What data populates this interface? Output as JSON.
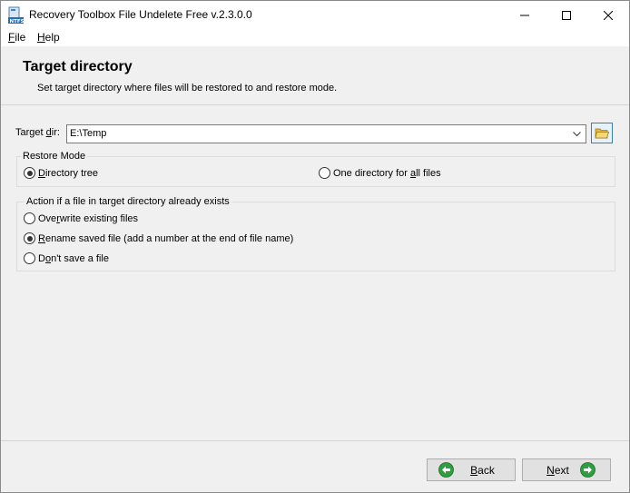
{
  "window": {
    "title": "Recovery Toolbox File Undelete Free v.2.3.0.0",
    "icon": "ntfs-app-icon"
  },
  "menu": {
    "file_first": "F",
    "file_rest": "ile",
    "help_first": "H",
    "help_rest": "elp"
  },
  "header": {
    "title": "Target directory",
    "subtitle": "Set target directory where files will be restored to and restore mode."
  },
  "target": {
    "label_pre": "Target ",
    "label_ul": "d",
    "label_post": "ir:",
    "value": "E:\\Temp"
  },
  "restore_mode": {
    "title": "Restore Mode",
    "options": [
      {
        "pre": "",
        "ul": "D",
        "post": "irectory tree",
        "checked": true
      },
      {
        "pre": "One directory for ",
        "ul": "a",
        "post": "ll files",
        "checked": false
      }
    ]
  },
  "action": {
    "title": "Action if a file in target directory already exists",
    "options": [
      {
        "pre": "Ove",
        "ul": "r",
        "post": "write existing files",
        "checked": false
      },
      {
        "pre": "",
        "ul": "R",
        "post": "ename saved file (add a number at the end of file name)",
        "checked": true
      },
      {
        "pre": "D",
        "ul": "o",
        "post": "n't save a file",
        "checked": false
      }
    ]
  },
  "buttons": {
    "back_ul": "B",
    "back_rest": "ack",
    "next_ul": "N",
    "next_rest": "ext"
  },
  "colors": {
    "accent_green": "#2e9e3e",
    "folder_yellow": "#f2c14e"
  }
}
